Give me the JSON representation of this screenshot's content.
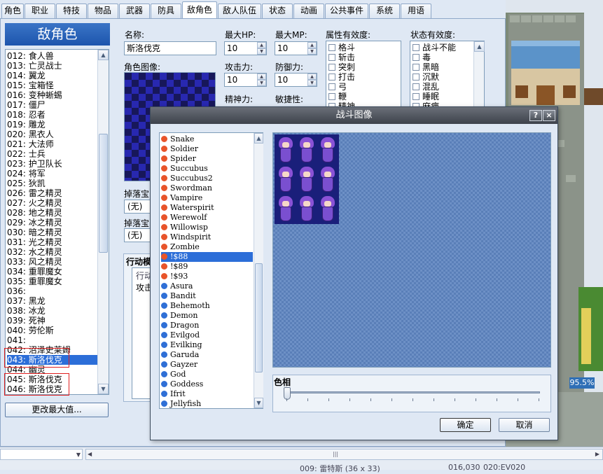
{
  "tabs": [
    "角色",
    "职业",
    "特技",
    "物品",
    "武器",
    "防具",
    "敌角色",
    "敌人队伍",
    "状态",
    "动画",
    "公共事件",
    "系统",
    "用语"
  ],
  "active_tab": "敌角色",
  "enemies": {
    "header": "敌角色",
    "items": [
      "012: 食人兽",
      "013: 亡灵战士",
      "014: 翼龙",
      "015: 宝箱怪",
      "016: 变种蜥蜴",
      "017: 僵尸",
      "018: 忍者",
      "019: 雕龙",
      "020: 黑衣人",
      "021: 大法师",
      "022: 士兵",
      "023: 护卫队长",
      "024: 将军",
      "025: 狄凯",
      "026: 雷之精灵",
      "027: 火之精灵",
      "028: 地之精灵",
      "029: 冰之精灵",
      "030: 暗之精灵",
      "031: 光之精灵",
      "032: 水之精灵",
      "033: 风之精灵",
      "034: 重罪魔女",
      "035: 重罪魔女",
      "036:",
      "037: 黑龙",
      "038: 冰龙",
      "039: 死神",
      "040: 劳伦斯",
      "041:",
      "042: 沼泽史莱姆",
      "043: 斯洛伐克",
      "044: 幽灵",
      "045: 斯洛伐克",
      "046: 斯洛伐克"
    ],
    "selected_index": 31,
    "change_max_label": "更改最大值..."
  },
  "form": {
    "name_label": "名称:",
    "name_value": "斯洛伐克",
    "image_label": "角色图像:",
    "maxhp_label": "最大HP:",
    "maxhp_value": "10",
    "maxmp_label": "最大MP:",
    "maxmp_value": "10",
    "atk_label": "攻击力:",
    "atk_value": "10",
    "def_label": "防御力:",
    "def_value": "10",
    "spi_label": "精神力:",
    "agi_label": "敏捷性:",
    "element_label": "属性有效度:",
    "elements": [
      "格斗",
      "斩击",
      "突刺",
      "打击",
      "弓",
      "鞭",
      "精神"
    ],
    "state_label": "状态有效度:",
    "states": [
      "战斗不能",
      "毒",
      "黑暗",
      "沉默",
      "混乱",
      "睡眠",
      "麻痹"
    ],
    "drop1_label": "掉落宝",
    "drop1_value": "(无)",
    "drop2_label": "掉落宝",
    "drop2_value": "(无)",
    "action_label": "行动模",
    "action_col": "行动",
    "action_row": "攻击"
  },
  "dialog": {
    "title": "战斗图像",
    "help_btn": "?",
    "close_btn": "×",
    "files": [
      {
        "name": "Snake",
        "color": "#e8542a"
      },
      {
        "name": "Soldier",
        "color": "#e8542a"
      },
      {
        "name": "Spider",
        "color": "#e8542a"
      },
      {
        "name": "Succubus",
        "color": "#e8542a"
      },
      {
        "name": "Succubus2",
        "color": "#e8542a"
      },
      {
        "name": "Swordman",
        "color": "#e8542a"
      },
      {
        "name": "Vampire",
        "color": "#e8542a"
      },
      {
        "name": "Waterspirit",
        "color": "#e8542a"
      },
      {
        "name": "Werewolf",
        "color": "#e8542a"
      },
      {
        "name": "Willowisp",
        "color": "#e8542a"
      },
      {
        "name": "Windspirit",
        "color": "#e8542a"
      },
      {
        "name": "Zombie",
        "color": "#e8542a"
      },
      {
        "name": "!$88",
        "color": "#e8542a"
      },
      {
        "name": "!$89",
        "color": "#e8542a"
      },
      {
        "name": "!$93",
        "color": "#e8542a"
      },
      {
        "name": "Asura",
        "color": "#2f6fd6"
      },
      {
        "name": "Bandit",
        "color": "#2f6fd6"
      },
      {
        "name": "Behemoth",
        "color": "#2f6fd6"
      },
      {
        "name": "Demon",
        "color": "#2f6fd6"
      },
      {
        "name": "Dragon",
        "color": "#2f6fd6"
      },
      {
        "name": "Evilgod",
        "color": "#2f6fd6"
      },
      {
        "name": "Evilking",
        "color": "#2f6fd6"
      },
      {
        "name": "Garuda",
        "color": "#2f6fd6"
      },
      {
        "name": "Gayzer",
        "color": "#2f6fd6"
      },
      {
        "name": "God",
        "color": "#2f6fd6"
      },
      {
        "name": "Goddess",
        "color": "#2f6fd6"
      },
      {
        "name": "Ifrit",
        "color": "#2f6fd6"
      },
      {
        "name": "Jellyfish",
        "color": "#2f6fd6"
      }
    ],
    "selected_index": 12,
    "hue_label": "色相",
    "hue_value": 0,
    "ok_label": "确定",
    "cancel_label": "取消"
  },
  "map_zoom": "95.5%",
  "status": {
    "map_info": "009: 雷特斯 (36 x 33)",
    "coords": "016,030",
    "event": "020:EV020"
  }
}
